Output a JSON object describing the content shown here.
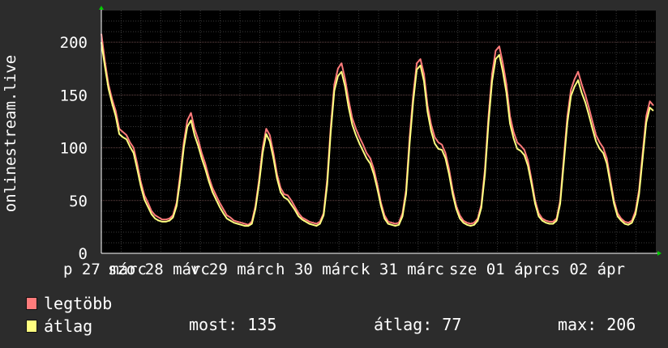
{
  "chart_data": {
    "type": "line",
    "ylabel": "onlinestream.live",
    "ylim": [
      0,
      230
    ],
    "y_ticks": [
      0,
      50,
      100,
      150,
      200
    ],
    "grid": true,
    "x_tick_labels": [
      "p 27 márc",
      "szo 28 márc",
      "v 29 márc",
      "h 30 márc",
      "k 31 márc",
      "sze 01 ápr",
      "cs 02 ápr"
    ],
    "series": [
      {
        "name": "legtöbb",
        "color": "#ff7b7b",
        "values": [
          208,
          182,
          160,
          146,
          135,
          118,
          115,
          112,
          105,
          100,
          85,
          68,
          55,
          48,
          40,
          36,
          34,
          32,
          32,
          33,
          36,
          48,
          75,
          105,
          126,
          133,
          118,
          108,
          95,
          85,
          72,
          62,
          55,
          48,
          42,
          36,
          34,
          31,
          30,
          29,
          28,
          27,
          30,
          45,
          70,
          100,
          118,
          112,
          95,
          75,
          62,
          56,
          55,
          50,
          44,
          38,
          34,
          32,
          30,
          29,
          28,
          30,
          38,
          70,
          120,
          160,
          175,
          180,
          165,
          145,
          128,
          118,
          110,
          103,
          95,
          90,
          80,
          65,
          48,
          36,
          30,
          29,
          28,
          29,
          38,
          60,
          110,
          150,
          180,
          184,
          170,
          140,
          122,
          110,
          105,
          103,
          95,
          80,
          60,
          45,
          36,
          31,
          29,
          28,
          29,
          33,
          46,
          80,
          130,
          170,
          192,
          196,
          180,
          160,
          130,
          115,
          105,
          102,
          98,
          88,
          70,
          50,
          38,
          33,
          31,
          30,
          30,
          33,
          50,
          90,
          130,
          155,
          165,
          172,
          160,
          150,
          138,
          125,
          112,
          105,
          100,
          90,
          70,
          50,
          38,
          33,
          30,
          29,
          31,
          40,
          60,
          95,
          130,
          144,
          140
        ]
      },
      {
        "name": "átlag",
        "color": "#ffff80",
        "values": [
          200,
          177,
          156,
          142,
          130,
          113,
          110,
          108,
          101,
          95,
          80,
          64,
          51,
          44,
          37,
          33,
          31,
          30,
          30,
          31,
          34,
          45,
          70,
          100,
          120,
          126,
          112,
          102,
          90,
          80,
          68,
          58,
          51,
          44,
          38,
          33,
          31,
          29,
          28,
          27,
          26,
          26,
          28,
          42,
          66,
          95,
          113,
          106,
          90,
          71,
          58,
          53,
          51,
          46,
          41,
          35,
          32,
          30,
          28,
          27,
          26,
          28,
          36,
          65,
          115,
          154,
          168,
          172,
          158,
          138,
          122,
          112,
          104,
          97,
          90,
          85,
          75,
          61,
          45,
          33,
          28,
          27,
          26,
          27,
          35,
          56,
          104,
          144,
          174,
          178,
          163,
          134,
          116,
          104,
          99,
          98,
          90,
          75,
          56,
          42,
          33,
          29,
          27,
          26,
          27,
          31,
          43,
          75,
          124,
          163,
          184,
          188,
          172,
          152,
          123,
          109,
          99,
          97,
          93,
          83,
          66,
          47,
          35,
          31,
          29,
          28,
          28,
          31,
          47,
          85,
          124,
          149,
          158,
          164,
          152,
          143,
          131,
          118,
          106,
          99,
          95,
          85,
          66,
          47,
          35,
          31,
          28,
          27,
          29,
          37,
          56,
          90,
          124,
          138,
          135
        ]
      }
    ]
  },
  "legend": {
    "max_label": "legtöbb",
    "avg_label": "átlag",
    "max_color": "#ff7b7b",
    "avg_color": "#ffff80"
  },
  "stats": {
    "now": "most: 135",
    "avg": "átlag: 77",
    "max": "max: 206"
  }
}
